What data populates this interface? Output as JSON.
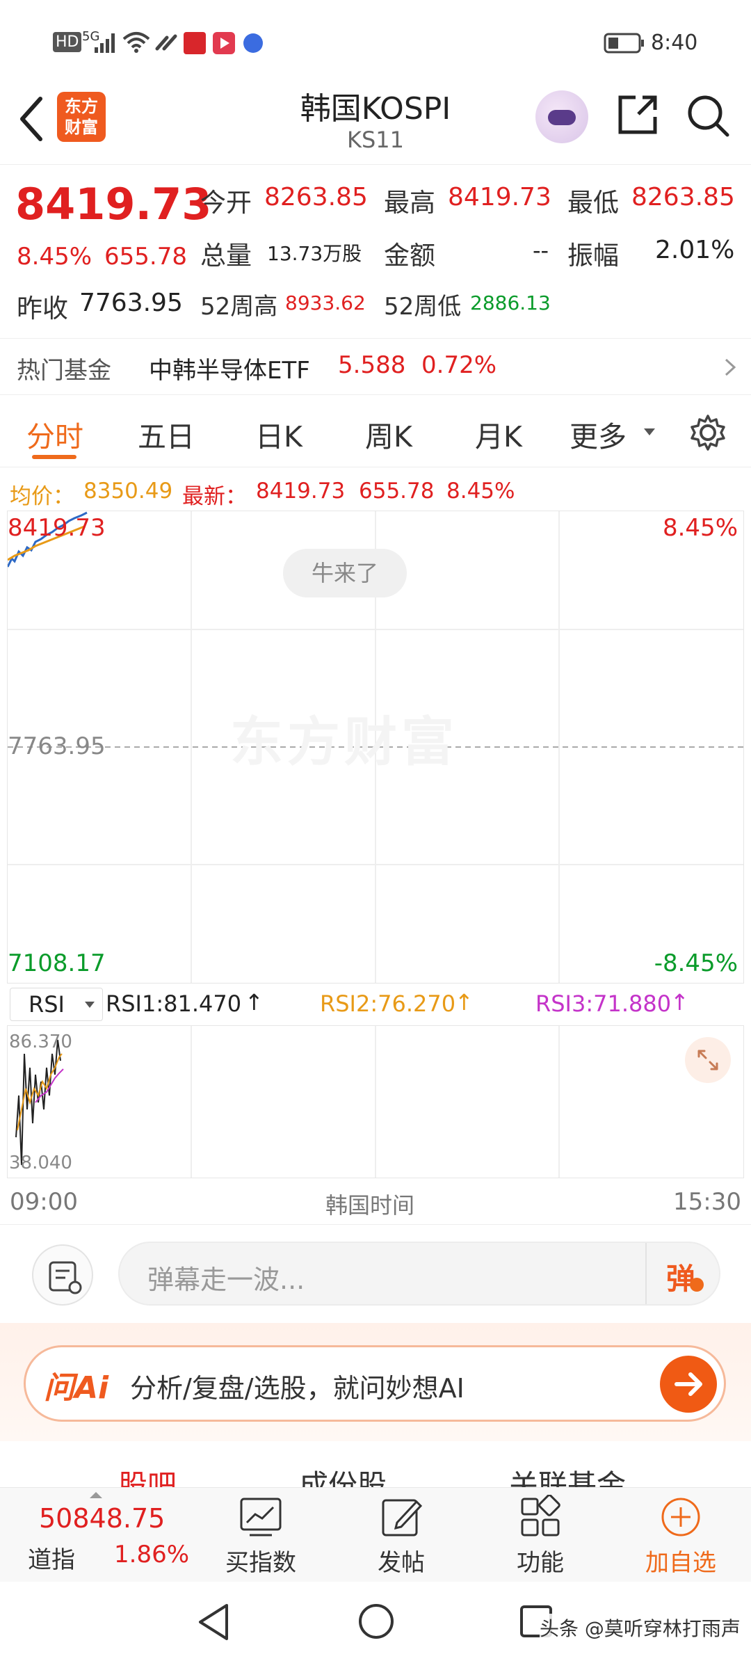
{
  "status_bar": {
    "left_indicators": "HD",
    "network": "5G",
    "battery": "",
    "time": "8:40"
  },
  "header": {
    "title": "韩国KOSPI",
    "subtitle": "KS11",
    "logo_line1": "东方",
    "logo_line2": "财富"
  },
  "quote": {
    "price": "8419.73",
    "change_pct": "8.45%",
    "change_val": "655.78",
    "open_label": "今开",
    "open_value": "8263.85",
    "high_label": "最高",
    "high_value": "8419.73",
    "low_label": "最低",
    "low_value": "8263.85",
    "volume_label": "总量",
    "volume_value": "13.73万股",
    "amount_label": "金额",
    "amount_value": "--",
    "amplitude_label": "振幅",
    "amplitude_value": "2.01%",
    "prev_close_label": "昨收",
    "prev_close_value": "7763.95",
    "wk52_high_label": "52周高",
    "wk52_high_value": "8933.62",
    "wk52_low_label": "52周低",
    "wk52_low_value": "2886.13"
  },
  "fund_row": {
    "label": "热门基金",
    "name": "中韩半导体ETF",
    "price": "5.588",
    "change": "0.72%"
  },
  "tabs": [
    "分时",
    "五日",
    "日K",
    "周K",
    "月K",
    "更多"
  ],
  "info_line": {
    "avg_label": "均价：",
    "avg_value": "8350.49",
    "latest_label": "最新：",
    "latest_value": "8419.73",
    "change_val": "655.78",
    "change_pct": "8.45%"
  },
  "chart": {
    "top_left": "8419.73",
    "top_right": "8.45%",
    "mid_left": "7763.95",
    "bottom_left": "7108.17",
    "bottom_right": "-8.45%",
    "bubble": "牛来了",
    "watermark": "东方财富"
  },
  "rsi": {
    "selector": "RSI",
    "rsi1": "RSI1:81.470",
    "rsi2": "RSI2:76.270",
    "rsi3": "RSI3:71.880",
    "top_label": "86.370",
    "bottom_label": "38.040",
    "colors": {
      "rsi1": "#222222",
      "rsi2": "#e89a17",
      "rsi3": "#c433c9"
    }
  },
  "time_axis": {
    "start": "09:00",
    "middle": "韩国时间",
    "end": "15:30"
  },
  "danmu": {
    "placeholder": "弹幕走一波...",
    "toggle": "弹"
  },
  "ai_bar": {
    "logo": "问Ai",
    "text": "分析/复盘/选股，就问妙想AI"
  },
  "sub_tabs": [
    "股吧",
    "成份股",
    "关联基金"
  ],
  "bottom_nav": {
    "index_value": "50848.75",
    "index_name": "道指",
    "index_change": "1.86%",
    "items": [
      "买指数",
      "发帖",
      "功能",
      "加自选"
    ]
  },
  "watermark_credit": "头条 @莫听穿林打雨声",
  "accent_color": "#ef6a1b",
  "up_color": "#e02020",
  "down_color": "#0a9b2a"
}
